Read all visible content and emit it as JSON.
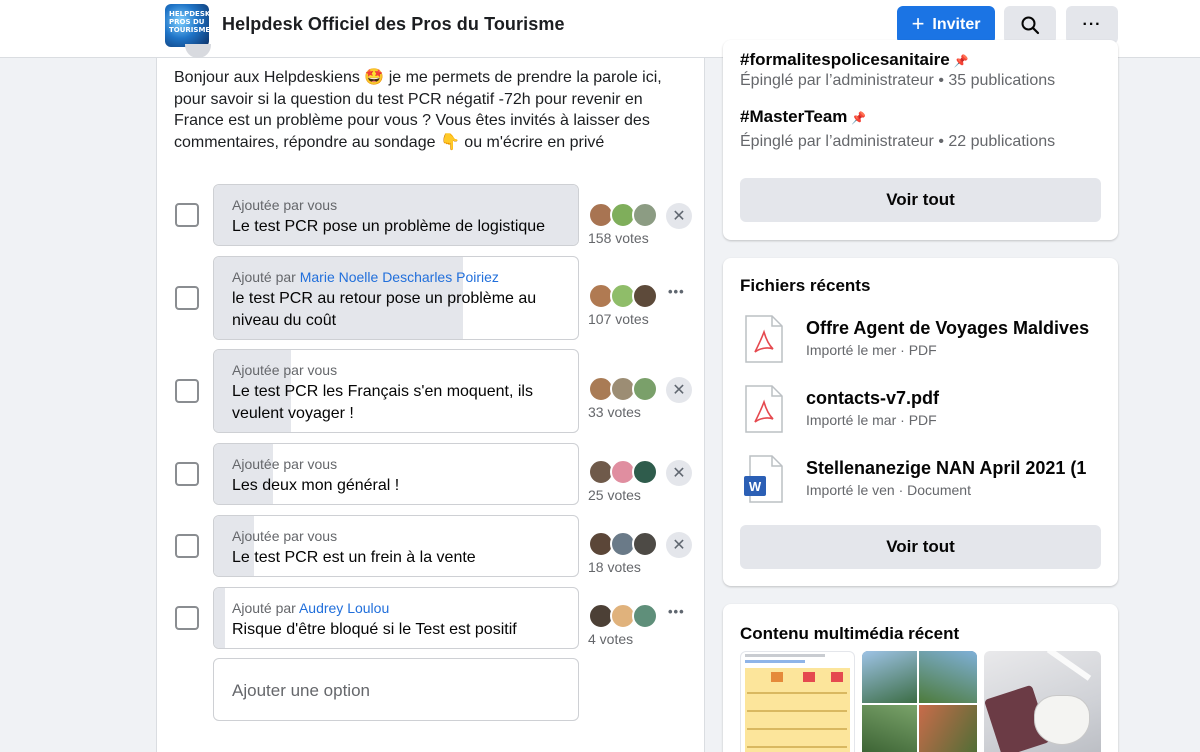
{
  "header": {
    "group_thumb_text": "HELPDESK PROS DU TOURISME",
    "group_title": "Helpdesk Officiel des Pros du Tourisme",
    "invite_label": "Inviter",
    "search_icon": "search-icon",
    "more_icon": "more-icon"
  },
  "post": {
    "text": "Bonjour aux Helpdeskiens 🤩 je me permets de prendre la parole ici, pour savoir si la question du test PCR négatif -72h pour revenir en France est un problème pour vous ? Vous êtes invités à laisser des commentaires, répondre au sondage 👇 ou m'écrire en privé",
    "poll_options": [
      {
        "meta_prefix": "Ajoutée par vous",
        "author": "",
        "text": "Le test PCR pose un problème de logistique",
        "votes": "158 votes",
        "share": 1.0,
        "action": "remove"
      },
      {
        "meta_prefix": "Ajouté par",
        "author": "Marie Noelle Descharles Poiriez",
        "text": "le test PCR au retour pose un problème au niveau du coût",
        "votes": "107 votes",
        "share": 0.68,
        "action": "more"
      },
      {
        "meta_prefix": "Ajoutée par vous",
        "author": "",
        "text": "Le test PCR les Français s'en moquent, ils veulent voyager !",
        "votes": "33 votes",
        "share": 0.21,
        "action": "remove"
      },
      {
        "meta_prefix": "Ajoutée par vous",
        "author": "",
        "text": "Les deux mon général !",
        "votes": "25 votes",
        "share": 0.16,
        "action": "remove"
      },
      {
        "meta_prefix": "Ajoutée par vous",
        "author": "",
        "text": "Le test PCR est un frein à la vente",
        "votes": "18 votes",
        "share": 0.11,
        "action": "remove"
      },
      {
        "meta_prefix": "Ajouté par",
        "author": "Audrey Loulou",
        "text": "Risque d'être bloqué si le Test est positif",
        "votes": "4 votes",
        "share": 0.03,
        "action": "more"
      }
    ],
    "add_option_placeholder": "Ajouter une option"
  },
  "hashtags_card": {
    "tags": [
      {
        "name": "#formalitespolicesanitaire",
        "sub": "Épinglé par l’administrateur • 35 publications"
      },
      {
        "name": "#MasterTeam",
        "sub": "Épinglé par l’administrateur • 22 publications"
      }
    ],
    "see_all": "Voir tout"
  },
  "files_card": {
    "title": "Fichiers récents",
    "files": [
      {
        "name": "Offre Agent de Voyages Maldives",
        "sub": "Importé le mer · PDF",
        "type": "pdf"
      },
      {
        "name": "contacts-v7.pdf",
        "sub": "Importé le mar · PDF",
        "type": "pdf"
      },
      {
        "name": "Stellenanezige NAN April 2021 (1",
        "sub": "Importé le ven · Document",
        "type": "word"
      }
    ],
    "see_all": "Voir tout"
  },
  "media_card": {
    "title": "Contenu multimédia récent"
  },
  "colors": {
    "accent": "#1b74e4",
    "link": "#216fdb",
    "bar_fill": "#e4e6eb",
    "pdf_red": "#e5494f",
    "word_blue": "#2b5fb5"
  }
}
